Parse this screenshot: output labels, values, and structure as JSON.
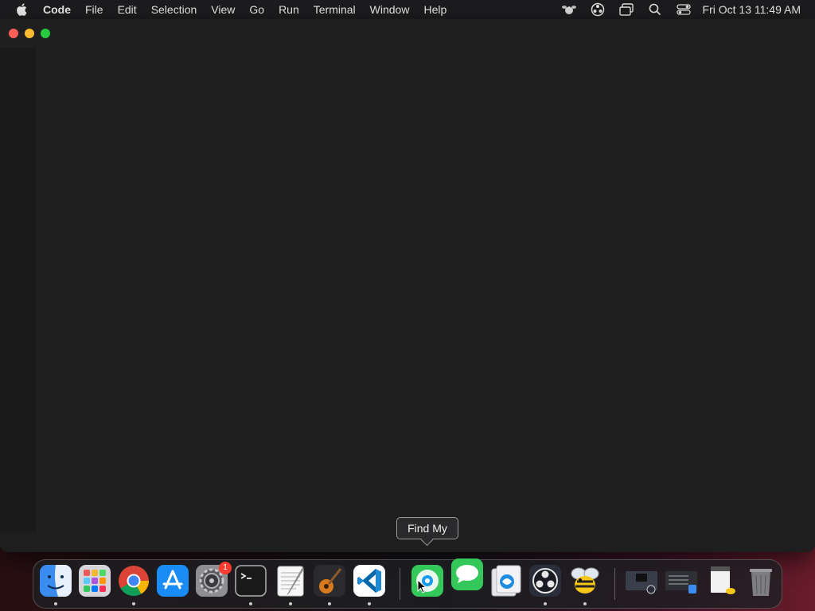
{
  "menubar": {
    "app_name": "Code",
    "items": [
      "File",
      "Edit",
      "Selection",
      "View",
      "Go",
      "Run",
      "Terminal",
      "Window",
      "Help"
    ],
    "clock": "Fri Oct 13  11:49 AM"
  },
  "dock": {
    "tooltip": "Find My",
    "settings_badge": "1",
    "apps": [
      "Finder",
      "Launchpad",
      "Google Chrome",
      "App Store",
      "System Settings",
      "Terminal",
      "TextEdit",
      "GarageBand",
      "Visual Studio Code",
      "Find My",
      "Messages",
      "Preview",
      "OBS",
      "Cyberduck"
    ]
  },
  "colors": {
    "close": "#ff5f57",
    "minimize": "#febc2e",
    "maximize": "#28c840",
    "editor_bg": "#1e1e1e"
  }
}
